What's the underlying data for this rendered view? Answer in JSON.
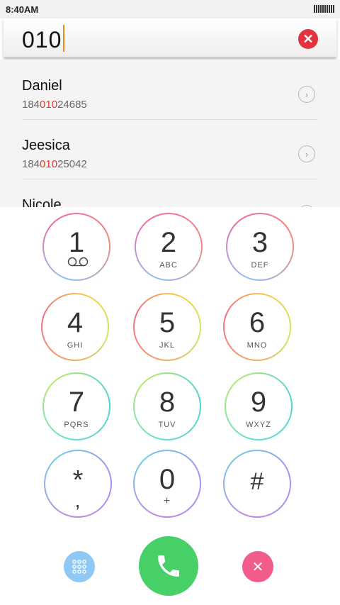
{
  "status": {
    "time": "8:40AM"
  },
  "search": {
    "value": "010"
  },
  "contacts": [
    {
      "name": "Daniel",
      "number_pre": "184",
      "number_match": "010",
      "number_post": "24685"
    },
    {
      "name": "Jeesica",
      "number_pre": "184",
      "number_match": "010",
      "number_post": "25042"
    },
    {
      "name": "Nicole"
    }
  ],
  "keys": [
    {
      "digit": "1",
      "letters": ""
    },
    {
      "digit": "2",
      "letters": "ABC"
    },
    {
      "digit": "3",
      "letters": "DEF"
    },
    {
      "digit": "4",
      "letters": "GHI"
    },
    {
      "digit": "5",
      "letters": "JKL"
    },
    {
      "digit": "6",
      "letters": "MNO"
    },
    {
      "digit": "7",
      "letters": "PQRS"
    },
    {
      "digit": "8",
      "letters": "TUV"
    },
    {
      "digit": "9",
      "letters": "WXYZ"
    },
    {
      "digit": "*",
      "letters": ","
    },
    {
      "digit": "0",
      "letters": "+"
    },
    {
      "digit": "#",
      "letters": ""
    }
  ],
  "colors": {
    "accent_match": "#e23b2e",
    "call_button": "#47cf68",
    "delete_button": "#f25c8a",
    "keypad_toggle": "#8fc8f4",
    "clear_button": "#e3333f"
  },
  "icons": {
    "clear": "close-icon",
    "voicemail": "voicemail-icon",
    "keypad_toggle": "dialpad-icon",
    "call": "phone-icon",
    "delete": "close-icon",
    "contact_detail": "chevron-right-icon"
  }
}
